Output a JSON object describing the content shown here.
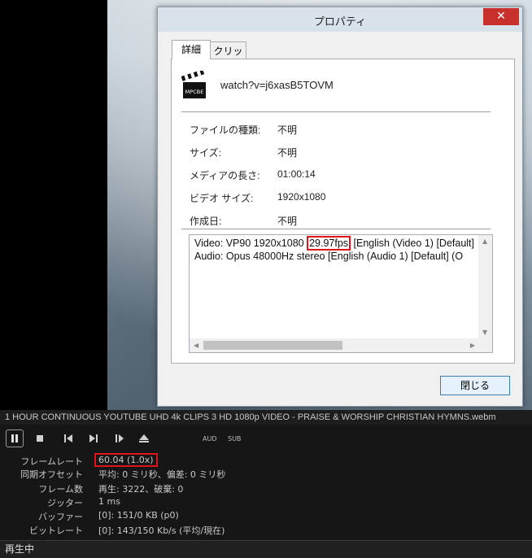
{
  "player": {
    "media_title": "1 HOUR CONTINUOUS YOUTUBE UHD 4k CLIPS 3 HD 1080p VIDEO - PRAISE & WORSHIP CHRISTIAN HYMNS.webm",
    "controls": {
      "pause": "pause-icon",
      "stop": "stop-icon",
      "prev": "previous-icon",
      "next": "next-icon",
      "frame_step": "frame-step-icon",
      "eject": "eject-icon",
      "aud": "AUD",
      "sub": "SUB"
    },
    "stats": [
      {
        "label": "フレームレート",
        "value": "60.04 (1.0x)"
      },
      {
        "label": "同期オフセット",
        "value": "平均: 0 ミリ秒、偏差: 0 ミリ秒"
      },
      {
        "label": "フレーム数",
        "value": "再生: 3222、破棄: 0"
      },
      {
        "label": "ジッター",
        "value": "1 ms"
      },
      {
        "label": "バッファー",
        "value": "[0]: 151/0 KB (p0)"
      },
      {
        "label": "ビットレート",
        "value": "[0]: 143/150 Kb/s (平均/現在)"
      }
    ],
    "status": "再生中"
  },
  "dialog": {
    "title": "プロパティ",
    "close_glyph": "✕",
    "tabs": [
      "詳細",
      "クリップ"
    ],
    "icon_label": "MPCBE",
    "filename": "watch?v=j6xasB5TOVM",
    "properties": [
      {
        "label": "ファイルの種類:",
        "value": "不明"
      },
      {
        "label": "サイズ:",
        "value": "不明"
      },
      {
        "label": "メディアの長さ:",
        "value": "01:00:14"
      },
      {
        "label": "ビデオ サイズ:",
        "value": "1920x1080"
      },
      {
        "label": "作成日:",
        "value": "不明"
      }
    ],
    "streams": {
      "video_prefix": "Video: VP90 1920x1080 ",
      "video_fps": "29.97fps",
      "video_suffix": " [English (Video 1) [Default]",
      "audio": "Audio: Opus 48000Hz stereo [English (Audio 1) [Default] (O"
    },
    "close_button": "閉じる"
  }
}
